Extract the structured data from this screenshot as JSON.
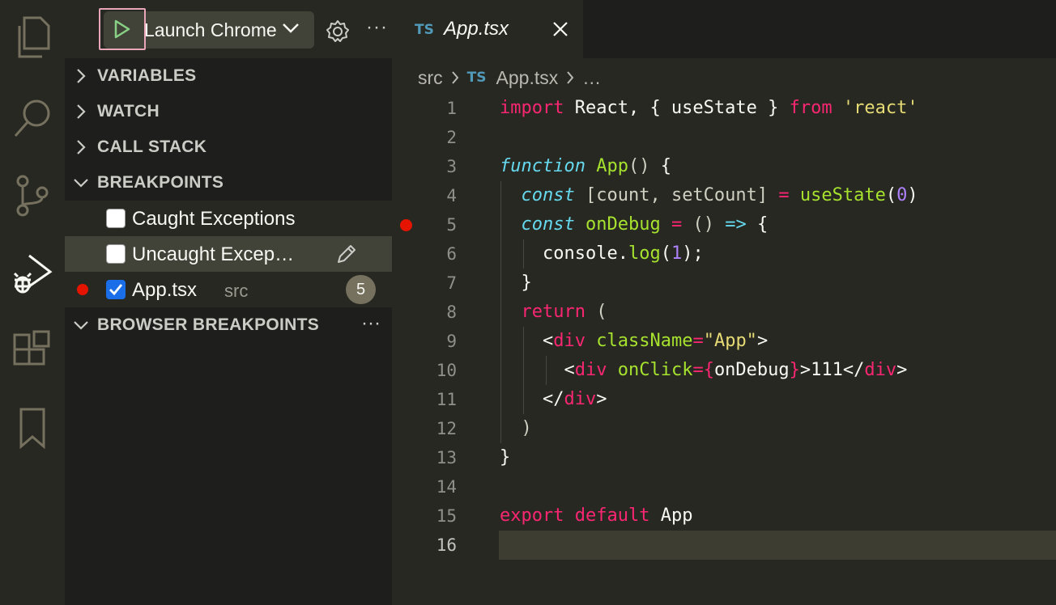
{
  "activity_bar": {
    "items": [
      {
        "name": "explorer-icon",
        "active": false
      },
      {
        "name": "search-icon",
        "active": false
      },
      {
        "name": "source-control-icon",
        "active": false
      },
      {
        "name": "run-debug-icon",
        "active": true
      },
      {
        "name": "extensions-icon",
        "active": false
      },
      {
        "name": "bookmarks-icon",
        "active": false
      }
    ]
  },
  "debug_toolbar": {
    "config_label": "Launch Chrome",
    "more_label": "···"
  },
  "sections": {
    "variables": "VARIABLES",
    "watch": "WATCH",
    "call_stack": "CALL STACK",
    "breakpoints": "BREAKPOINTS",
    "browser_breakpoints": "BROWSER BREAKPOINTS",
    "browser_breakpoints_more": "···"
  },
  "breakpoints": [
    {
      "label": "Caught Exceptions",
      "checked": false
    },
    {
      "label": "Uncaught Excep…",
      "checked": false
    },
    {
      "label": "App.tsx",
      "description": "src",
      "checked": true,
      "line": "5"
    }
  ],
  "editor": {
    "tab": {
      "lang_badge": "TS",
      "title": "App.tsx"
    },
    "breadcrumbs": {
      "folder": "src",
      "lang_badge": "TS",
      "file": "App.tsx",
      "more": "…"
    },
    "line_numbers": [
      "1",
      "2",
      "3",
      "4",
      "5",
      "6",
      "7",
      "8",
      "9",
      "10",
      "11",
      "12",
      "13",
      "14",
      "15",
      "16"
    ],
    "current_line": "16",
    "breakpoint_line": "5"
  },
  "colors": {
    "keyword": "#f92672",
    "function": "#a6e22e",
    "storage": "#66d9ef",
    "string": "#e6db74",
    "number": "#ae81ff",
    "breakpoint": "#e51400",
    "checkbox_checked": "#1a6fe8"
  }
}
